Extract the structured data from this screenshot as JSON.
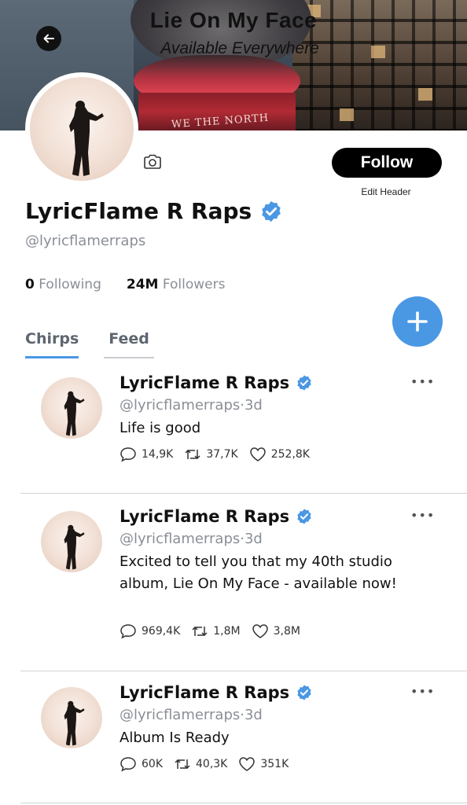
{
  "banner": {
    "title": "Lie On My Face",
    "subtitle": "Available Everywhere",
    "building_sign": "WE THE NORTH"
  },
  "profile": {
    "name": "LyricFlame R Raps",
    "handle": "@lyricflamerraps",
    "following_count": "0",
    "following_label": "Following",
    "followers_count": "24M",
    "followers_label": "Followers",
    "follow_label": "Follow",
    "edit_header_label": "Edit Header",
    "verified": true
  },
  "tabs": [
    {
      "label": "Chirps",
      "active": true
    },
    {
      "label": "Feed",
      "active": false
    }
  ],
  "posts": [
    {
      "name": "LyricFlame R Raps",
      "handle": "@lyricflamerraps",
      "time": "3d",
      "text": "Life is good",
      "replies": "14,9K",
      "rechirps": "37,7K",
      "likes": "252,8K"
    },
    {
      "name": "LyricFlame R Raps",
      "handle": "@lyricflamerraps",
      "time": "3d",
      "text": "Excited to tell you that my 40th studio album, Lie On My Face - available now!",
      "replies": "969,4K",
      "rechirps": "1,8M",
      "likes": "3,8M"
    },
    {
      "name": "LyricFlame R Raps",
      "handle": "@lyricflamerraps",
      "time": "3d",
      "text": "Album Is Ready",
      "replies": "60K",
      "rechirps": "40,3K",
      "likes": "351K"
    }
  ],
  "colors": {
    "accent": "#4a97e4",
    "follow_bg": "#000000",
    "muted_text": "#8a8f96"
  },
  "icons": {
    "back": "arrow-left-icon",
    "camera": "camera-icon",
    "verified": "verified-badge-icon",
    "compose": "plus-icon",
    "reply": "speech-bubble-icon",
    "rechirp": "repost-icon",
    "like": "heart-icon",
    "more": "ellipsis-icon"
  }
}
